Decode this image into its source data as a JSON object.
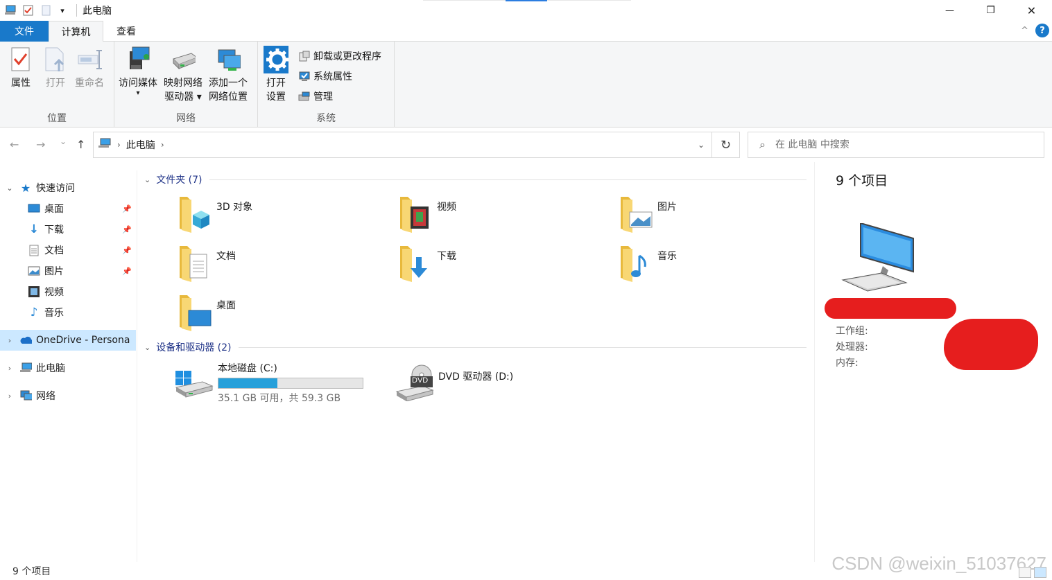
{
  "window": {
    "title": "此电脑",
    "qat_dropdown": "▾",
    "min": "—",
    "max": "❐",
    "close": "✕"
  },
  "tabs": {
    "file": "文件",
    "computer": "计算机",
    "view": "查看",
    "collapse": "^",
    "help": "?"
  },
  "ribbon": {
    "location": {
      "label": "位置",
      "properties": "属性",
      "open": "打开",
      "rename": "重命名"
    },
    "network": {
      "label": "网络",
      "access_media_1": "访问媒体",
      "access_media_2": "▾",
      "map_drive_1": "映射网络",
      "map_drive_2": "驱动器 ▾",
      "add_location_1": "添加一个",
      "add_location_2": "网络位置"
    },
    "system": {
      "label": "系统",
      "open_settings_1": "打开",
      "open_settings_2": "设置",
      "uninstall": "卸载或更改程序",
      "system_props": "系统属性",
      "manage": "管理"
    }
  },
  "nav": {
    "back": "←",
    "forward": "→",
    "recent": "⌄",
    "up": "↑",
    "path_root": "此电脑",
    "refresh": "↻",
    "search_placeholder": "在 此电脑 中搜索"
  },
  "sidebar": {
    "quick_access": "快速访问",
    "items": [
      {
        "label": "桌面",
        "icon": "desktop-icon"
      },
      {
        "label": "下载",
        "icon": "download-icon"
      },
      {
        "label": "文档",
        "icon": "document-icon"
      },
      {
        "label": "图片",
        "icon": "picture-icon"
      },
      {
        "label": "视频",
        "icon": "video-icon"
      },
      {
        "label": "音乐",
        "icon": "music-icon"
      }
    ],
    "onedrive": "OneDrive - Persona",
    "this_pc": "此电脑",
    "network": "网络"
  },
  "main": {
    "folders_header": "文件夹 (7)",
    "folders": [
      {
        "label": "3D 对象",
        "icon": "3d-objects-folder-icon"
      },
      {
        "label": "视频",
        "icon": "videos-folder-icon"
      },
      {
        "label": "图片",
        "icon": "pictures-folder-icon"
      },
      {
        "label": "文档",
        "icon": "documents-folder-icon"
      },
      {
        "label": "下载",
        "icon": "downloads-folder-icon"
      },
      {
        "label": "音乐",
        "icon": "music-folder-icon"
      },
      {
        "label": "桌面",
        "icon": "desktop-folder-icon"
      }
    ],
    "devices_header": "设备和驱动器 (2)",
    "drive_c": {
      "label": "本地磁盘 (C:)",
      "free_text": "35.1 GB 可用，共 59.3 GB",
      "used_fraction": 0.41
    },
    "drive_d": {
      "label": "DVD 驱动器 (D:)",
      "badge": "DVD"
    }
  },
  "details": {
    "count": "9 个项目",
    "workgroup": "工作组:",
    "processor": "处理器:",
    "memory": "内存:"
  },
  "status": {
    "count": "9 个项目",
    "watermark": "CSDN @weixin_51037627"
  },
  "colors": {
    "accent": "#1979ca",
    "selected": "#cce8ff",
    "capacity": "#26a0da",
    "redaction": "#e61e1e"
  }
}
